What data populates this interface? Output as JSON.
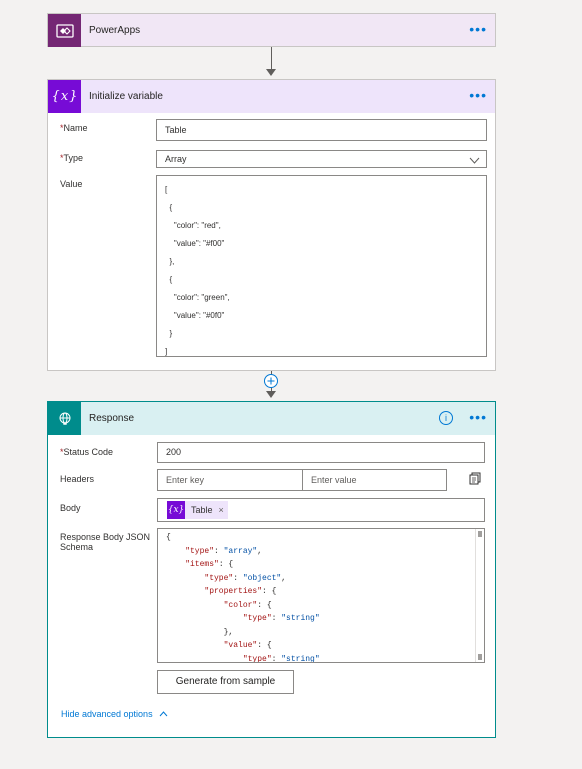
{
  "cards": {
    "powerapps": {
      "title": "PowerApps",
      "more": "•••"
    },
    "init": {
      "title": "Initialize variable",
      "more": "•••",
      "name_label": "Name",
      "type_label": "Type",
      "value_label": "Value",
      "required_mark": "*",
      "name_value": "Table",
      "type_value": "Array",
      "value_lines": [
        "[",
        "  {",
        "    \"color\": \"red\",",
        "    \"value\": \"#f00\"",
        "  },",
        "  {",
        "    \"color\": \"green\",",
        "    \"value\": \"#0f0\"",
        "  }",
        "]"
      ]
    },
    "response": {
      "title": "Response",
      "more": "•••",
      "status_label": "Status Code",
      "headers_label": "Headers",
      "body_label": "Body",
      "schema_label": "Response Body JSON Schema",
      "required_mark": "*",
      "status_value": "200",
      "key_placeholder": "Enter key",
      "value_placeholder": "Enter value",
      "body_token": "Table",
      "schema_lines": [
        "{",
        "    \"type\": \"array\",",
        "    \"items\": {",
        "        \"type\": \"object\",",
        "        \"properties\": {",
        "            \"color\": {",
        "                \"type\": \"string\"",
        "            },",
        "            \"value\": {",
        "                \"type\": \"string\""
      ],
      "generate_button": "Generate from sample",
      "hide_advanced": "Hide advanced options"
    }
  },
  "icons": {
    "powerapps": "powerapps-icon",
    "variable": "variable-icon",
    "response": "globe-icon",
    "info": "info-icon",
    "add": "add-step-icon",
    "switch": "switch-to-text-mode-icon",
    "remove": "remove-token-icon"
  },
  "colors": {
    "powerapps_header": "#f1e7f5",
    "powerapps_icon": "#742774",
    "variable_header": "#eee4fb",
    "variable_icon": "#770bd6",
    "response_header": "#d9f0f2",
    "response_icon": "#008c8c",
    "link": "#0078d4"
  }
}
